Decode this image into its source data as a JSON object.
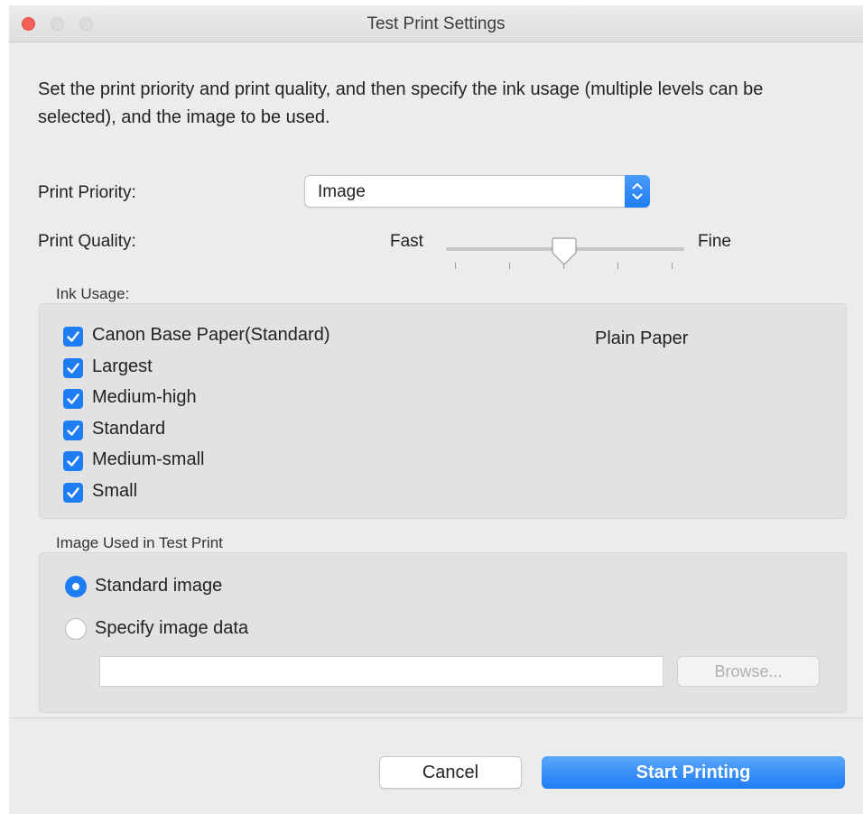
{
  "window": {
    "title": "Test Print Settings"
  },
  "intro": {
    "text": "Set the print priority and print quality, and then specify the ink usage (multiple levels can be selected), and the image to be used."
  },
  "print_priority": {
    "label": "Print Priority:",
    "value": "Image"
  },
  "print_quality": {
    "label": "Print Quality:",
    "min_label": "Fast",
    "max_label": "Fine",
    "ticks": 5,
    "value_fraction": 0.5
  },
  "ink_usage": {
    "label": "Ink Usage:",
    "paper_type": "Plain Paper",
    "items": [
      {
        "label": "Canon Base Paper(Standard)",
        "checked": true
      },
      {
        "label": "Largest",
        "checked": true
      },
      {
        "label": "Medium-high",
        "checked": true
      },
      {
        "label": "Standard",
        "checked": true
      },
      {
        "label": "Medium-small",
        "checked": true
      },
      {
        "label": "Small",
        "checked": true
      }
    ]
  },
  "image_section": {
    "label": "Image Used in Test Print",
    "options": [
      {
        "label": "Standard image",
        "selected": true
      },
      {
        "label": "Specify image data",
        "selected": false
      }
    ],
    "path_value": "",
    "browse_label": "Browse..."
  },
  "buttons": {
    "cancel_label": "Cancel",
    "start_label": "Start Printing"
  },
  "colors": {
    "accent": "#1f7df3",
    "close": "#f25f57",
    "window_bg": "#ececec"
  }
}
